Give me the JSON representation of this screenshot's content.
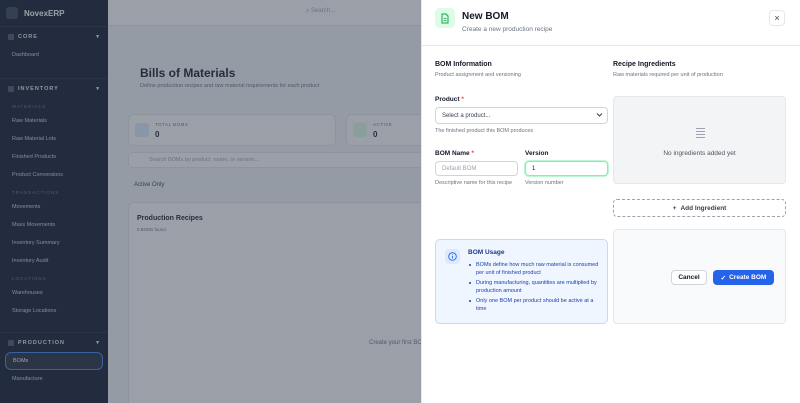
{
  "app": {
    "brand": "NovexERP",
    "top_search_placeholder": "Search..."
  },
  "sidebar": {
    "sections": [
      {
        "label": "CORE",
        "items": [
          "Dashboard"
        ]
      },
      {
        "label": "INVENTORY"
      }
    ],
    "materials_header": "MATERIALS",
    "materials_items": [
      "Raw Materials",
      "Raw Material Lots",
      "Finished Products",
      "Product Conversions"
    ],
    "transactions_header": "TRANSACTIONS",
    "transactions_items": [
      "Movements",
      "Mass Movements",
      "Inventory Summary",
      "Inventory Audit"
    ],
    "locations_header": "LOCATIONS",
    "locations_items": [
      "Warehouses",
      "Storage Locations"
    ],
    "production_label": "PRODUCTION",
    "production_items": [
      "BOMs",
      "Manufacture"
    ]
  },
  "page": {
    "title": "Bills of Materials",
    "description": "Define production recipes and raw material requirements for each product",
    "stats": [
      {
        "label": "TOTAL BOMS",
        "value": "0"
      },
      {
        "label": "ACTIVE",
        "value": "0"
      }
    ],
    "search_placeholder": "Search BOMs by product, name, or version...",
    "filter_label": "Active Only",
    "card_title": "Production Recipes",
    "card_count": "0 BOMs found",
    "empty_text": "Create your first BOM"
  },
  "panel": {
    "title": "New BOM",
    "subtitle": "Create a new production recipe",
    "close_glyph": "×",
    "bom_info": {
      "title": "BOM Information",
      "subtitle": "Product assignment and versioning"
    },
    "product": {
      "label": "Product",
      "required_mark": "*",
      "selected": "Select a product...",
      "hint": "The finished product this BOM produces"
    },
    "bom_name": {
      "label": "BOM Name",
      "required_mark": "*",
      "placeholder": "Default BOM",
      "hint": "Descriptive name for this recipe"
    },
    "version": {
      "label": "Version",
      "value": "1",
      "hint": "Version number"
    },
    "ingredients": {
      "title": "Recipe Ingredients",
      "subtitle": "Raw materials required per unit of production",
      "empty_message": "No ingredients added yet",
      "add_label": "Add Ingredient",
      "add_glyph": "+"
    },
    "usage": {
      "title": "BOM Usage",
      "bullets": [
        "BOMs define how much raw material is consumed per unit of finished product",
        "During manufacturing, quantities are multiplied by production amount",
        "Only one BOM per product should be active at a time"
      ]
    },
    "actions": {
      "cancel_label": "Cancel",
      "create_label": "Create BOM",
      "check_glyph": "✓"
    }
  },
  "colors": {
    "primary": "#2563eb",
    "success_bg": "#dcfce7",
    "info_bg": "#eff6ff",
    "required": "#ef4444"
  }
}
